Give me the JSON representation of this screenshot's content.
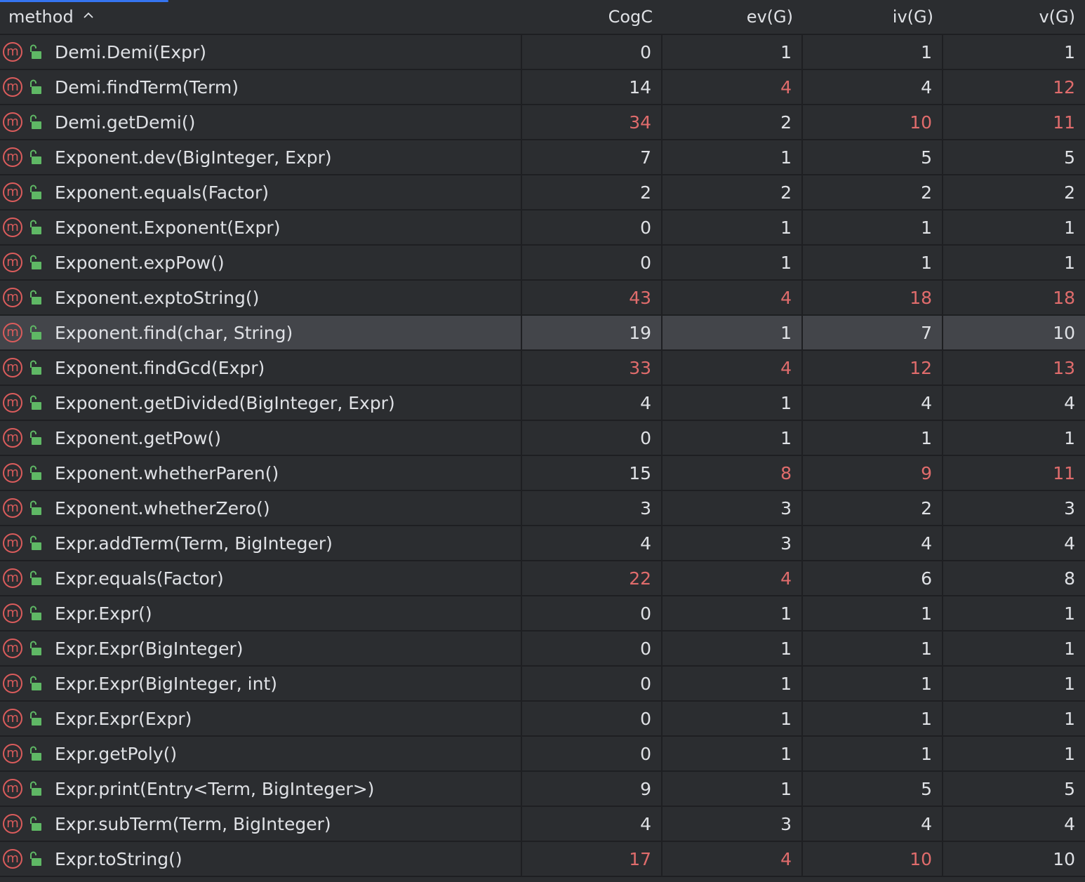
{
  "header": {
    "method": "method",
    "columns": [
      "CogC",
      "ev(G)",
      "iv(G)",
      "v(G)"
    ]
  },
  "colors": {
    "normal": "#dfe1e5",
    "warning": "#e06c6c",
    "method_icon": "#db5c5c",
    "lock_icon": "#5fb865"
  },
  "icons": {
    "method": "method-icon",
    "visibility": "unlocked-padlock-icon",
    "sort": "chevron-up-icon"
  },
  "method_icon_letter": "m",
  "selected_row": 8,
  "rows": [
    {
      "method": "Demi.Demi(Expr)",
      "values": [
        "0",
        "1",
        "1",
        "1"
      ],
      "red": [
        false,
        false,
        false,
        false
      ]
    },
    {
      "method": "Demi.findTerm(Term)",
      "values": [
        "14",
        "4",
        "4",
        "12"
      ],
      "red": [
        false,
        true,
        false,
        true
      ]
    },
    {
      "method": "Demi.getDemi()",
      "values": [
        "34",
        "2",
        "10",
        "11"
      ],
      "red": [
        true,
        false,
        true,
        true
      ]
    },
    {
      "method": "Exponent.dev(BigInteger, Expr)",
      "values": [
        "7",
        "1",
        "5",
        "5"
      ],
      "red": [
        false,
        false,
        false,
        false
      ]
    },
    {
      "method": "Exponent.equals(Factor)",
      "values": [
        "2",
        "2",
        "2",
        "2"
      ],
      "red": [
        false,
        false,
        false,
        false
      ]
    },
    {
      "method": "Exponent.Exponent(Expr)",
      "values": [
        "0",
        "1",
        "1",
        "1"
      ],
      "red": [
        false,
        false,
        false,
        false
      ]
    },
    {
      "method": "Exponent.expPow()",
      "values": [
        "0",
        "1",
        "1",
        "1"
      ],
      "red": [
        false,
        false,
        false,
        false
      ]
    },
    {
      "method": "Exponent.exptoString()",
      "values": [
        "43",
        "4",
        "18",
        "18"
      ],
      "red": [
        true,
        true,
        true,
        true
      ]
    },
    {
      "method": "Exponent.find(char, String)",
      "values": [
        "19",
        "1",
        "7",
        "10"
      ],
      "red": [
        false,
        false,
        false,
        false
      ]
    },
    {
      "method": "Exponent.findGcd(Expr)",
      "values": [
        "33",
        "4",
        "12",
        "13"
      ],
      "red": [
        true,
        true,
        true,
        true
      ]
    },
    {
      "method": "Exponent.getDivided(BigInteger, Expr)",
      "values": [
        "4",
        "1",
        "4",
        "4"
      ],
      "red": [
        false,
        false,
        false,
        false
      ]
    },
    {
      "method": "Exponent.getPow()",
      "values": [
        "0",
        "1",
        "1",
        "1"
      ],
      "red": [
        false,
        false,
        false,
        false
      ]
    },
    {
      "method": "Exponent.whetherParen()",
      "values": [
        "15",
        "8",
        "9",
        "11"
      ],
      "red": [
        false,
        true,
        true,
        true
      ]
    },
    {
      "method": "Exponent.whetherZero()",
      "values": [
        "3",
        "3",
        "2",
        "3"
      ],
      "red": [
        false,
        false,
        false,
        false
      ]
    },
    {
      "method": "Expr.addTerm(Term, BigInteger)",
      "values": [
        "4",
        "3",
        "4",
        "4"
      ],
      "red": [
        false,
        false,
        false,
        false
      ]
    },
    {
      "method": "Expr.equals(Factor)",
      "values": [
        "22",
        "4",
        "6",
        "8"
      ],
      "red": [
        true,
        true,
        false,
        false
      ]
    },
    {
      "method": "Expr.Expr()",
      "values": [
        "0",
        "1",
        "1",
        "1"
      ],
      "red": [
        false,
        false,
        false,
        false
      ]
    },
    {
      "method": "Expr.Expr(BigInteger)",
      "values": [
        "0",
        "1",
        "1",
        "1"
      ],
      "red": [
        false,
        false,
        false,
        false
      ]
    },
    {
      "method": "Expr.Expr(BigInteger, int)",
      "values": [
        "0",
        "1",
        "1",
        "1"
      ],
      "red": [
        false,
        false,
        false,
        false
      ]
    },
    {
      "method": "Expr.Expr(Expr)",
      "values": [
        "0",
        "1",
        "1",
        "1"
      ],
      "red": [
        false,
        false,
        false,
        false
      ]
    },
    {
      "method": "Expr.getPoly()",
      "values": [
        "0",
        "1",
        "1",
        "1"
      ],
      "red": [
        false,
        false,
        false,
        false
      ]
    },
    {
      "method": "Expr.print(Entry<Term, BigInteger>)",
      "values": [
        "9",
        "1",
        "5",
        "5"
      ],
      "red": [
        false,
        false,
        false,
        false
      ]
    },
    {
      "method": "Expr.subTerm(Term, BigInteger)",
      "values": [
        "4",
        "3",
        "4",
        "4"
      ],
      "red": [
        false,
        false,
        false,
        false
      ]
    },
    {
      "method": "Expr.toString()",
      "values": [
        "17",
        "4",
        "10",
        "10"
      ],
      "red": [
        true,
        true,
        true,
        false
      ]
    }
  ]
}
